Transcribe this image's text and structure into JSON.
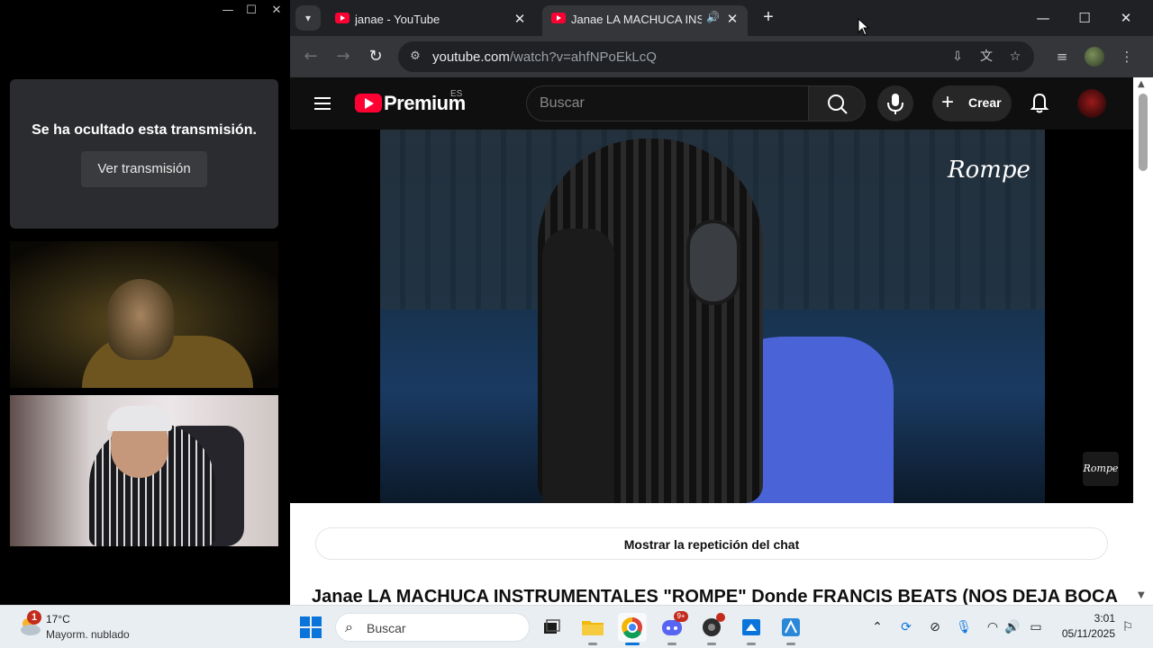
{
  "left_window": {
    "controls": {
      "minimize": "—",
      "maximize": "☐",
      "close": "✕"
    },
    "hidden_message": "Se ha ocultado esta transmisión.",
    "show_button": "Ver transmisión"
  },
  "browser": {
    "tabs": [
      {
        "title": "janae - YouTube",
        "active": false
      },
      {
        "title": "Janae LA MACHUCA INSTRUMENTALES",
        "active": true,
        "audio_icon": "🔊"
      }
    ],
    "new_tab": "+",
    "tab_close": "✕",
    "window_controls": {
      "minimize": "—",
      "maximize": "☐",
      "close": "✕"
    },
    "url_host": "youtube.com",
    "url_path": "/watch?v=ahfNPoEkLcQ",
    "nav": {
      "back": "←",
      "forward": "→",
      "reload": "↻"
    }
  },
  "youtube": {
    "logo_text": "Premium",
    "region": "ES",
    "search_placeholder": "Buscar",
    "create_label": "Crear",
    "video_brand": "Rompe",
    "watermark": "Rompe",
    "chat_replay_label": "Mostrar la repetición del chat",
    "video_title": "Janae LA MACHUCA INSTRUMENTALES \"ROMPE\" Donde FRANCIS BEATS (NOS DEJA BOCA"
  },
  "taskbar": {
    "weather_badge": "1",
    "weather_temp": "17°C",
    "weather_desc": "Mayorm. nublado",
    "search_placeholder": "Buscar",
    "time": "3:01",
    "date": "05/11/2025",
    "discord_badge": "9+"
  },
  "colors": {
    "youtube_red": "#ff0033",
    "chrome_dark": "#202124",
    "toolbar": "#35363a",
    "taskbar_bg": "#e9eef2",
    "windows_blue": "#0a74da"
  }
}
